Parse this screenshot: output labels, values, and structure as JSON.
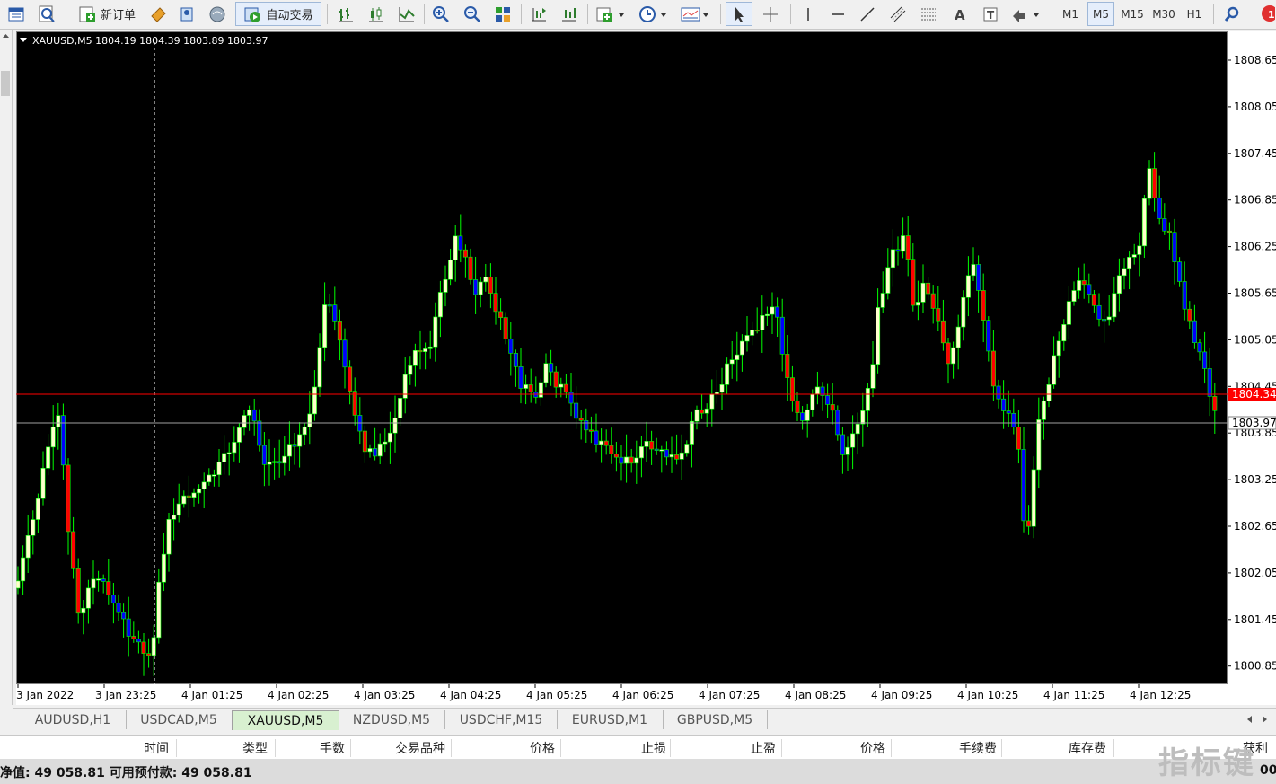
{
  "toolbar": {
    "new_order": "新订单",
    "auto_trade": "自动交易",
    "timeframes": [
      "M1",
      "M5",
      "M15",
      "M30",
      "H1"
    ],
    "active_timeframe": "M5"
  },
  "chart": {
    "header": "XAUUSD,M5  1804.19 1804.39 1803.89 1803.97",
    "background": "#000000",
    "bull_color": "#ffffcc",
    "bear_color": "#0000ff",
    "wick_color": "#00ff00",
    "bid_line_color": "#ff0000",
    "ask_line_color": "#c0c0c0"
  },
  "price_scale": {
    "ticks": [
      "1808.65",
      "1808.05",
      "1807.45",
      "1806.85",
      "1806.25",
      "1805.65",
      "1805.05",
      "1804.45",
      "1803.85",
      "1803.25",
      "1802.65",
      "1802.05",
      "1801.45",
      "1800.85"
    ],
    "bid_label": "1804.34",
    "ask_label": "1803.97"
  },
  "time_scale": {
    "ticks": [
      "3 Jan 2022",
      "3 Jan 23:25",
      "4 Jan 01:25",
      "4 Jan 02:25",
      "4 Jan 03:25",
      "4 Jan 04:25",
      "4 Jan 05:25",
      "4 Jan 06:25",
      "4 Jan 07:25",
      "4 Jan 08:25",
      "4 Jan 09:25",
      "4 Jan 10:25",
      "4 Jan 11:25",
      "4 Jan 12:25"
    ]
  },
  "symbol_tabs": [
    "AUDUSD,H1",
    "USDCAD,M5",
    "XAUUSD,M5",
    "NZDUSD,M5",
    "USDCHF,M15",
    "EURUSD,M1",
    "GBPUSD,M5"
  ],
  "active_symbol_tab": "XAUUSD,M5",
  "terminal": {
    "columns": [
      "时间",
      "类型",
      "手数",
      "交易品种",
      "价格",
      "止损",
      "止盈",
      "价格",
      "手续费",
      "库存费",
      "获利"
    ]
  },
  "status": {
    "text": "净值: 49 058.81  可用预付款: 49 058.81",
    "right_text": "00"
  },
  "watermark": "指标键",
  "chart_data": {
    "type": "candlestick",
    "symbol": "XAUUSD",
    "timeframe": "M5",
    "ylim": [
      1800.65,
      1809.0
    ],
    "last_bar": {
      "open": 1804.19,
      "high": 1804.39,
      "low": 1803.89,
      "close": 1803.97
    }
  }
}
